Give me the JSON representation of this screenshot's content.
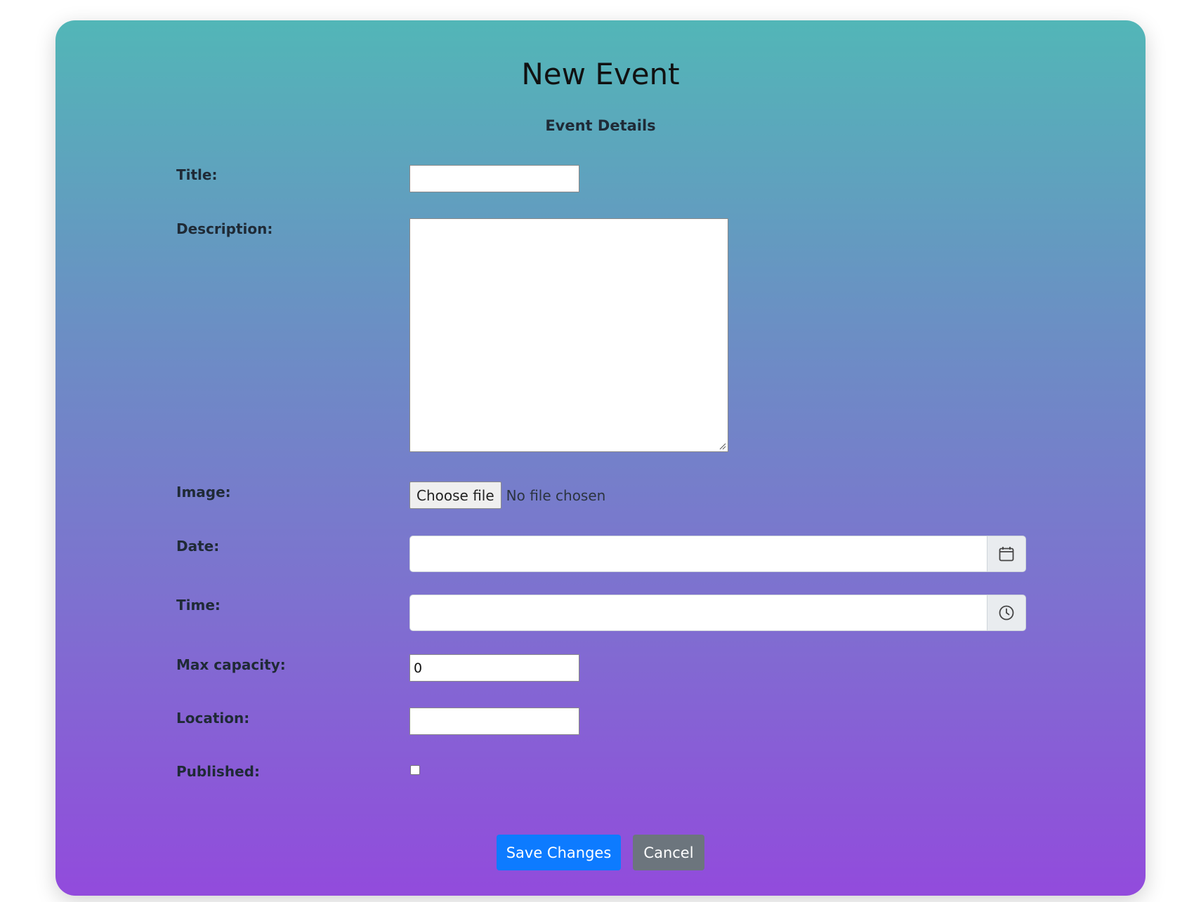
{
  "form": {
    "title": "New Event",
    "subtitle": "Event Details",
    "fields": {
      "title": {
        "label": "Title:",
        "value": ""
      },
      "description": {
        "label": "Description:",
        "value": ""
      },
      "image": {
        "label": "Image:",
        "button": "Choose file",
        "status": "No file chosen"
      },
      "date": {
        "label": "Date:",
        "value": "",
        "icon": "calendar-icon"
      },
      "time": {
        "label": "Time:",
        "value": "",
        "icon": "clock-icon"
      },
      "max_capacity": {
        "label": "Max capacity:",
        "value": "0"
      },
      "location": {
        "label": "Location:",
        "value": ""
      },
      "published": {
        "label": "Published:",
        "checked": false
      }
    },
    "actions": {
      "save": "Save Changes",
      "cancel": "Cancel"
    }
  },
  "colors": {
    "gradient_top": "#52b6b7",
    "gradient_bottom": "#924bdc",
    "primary": "#0d7bff",
    "secondary": "#6c757d"
  }
}
